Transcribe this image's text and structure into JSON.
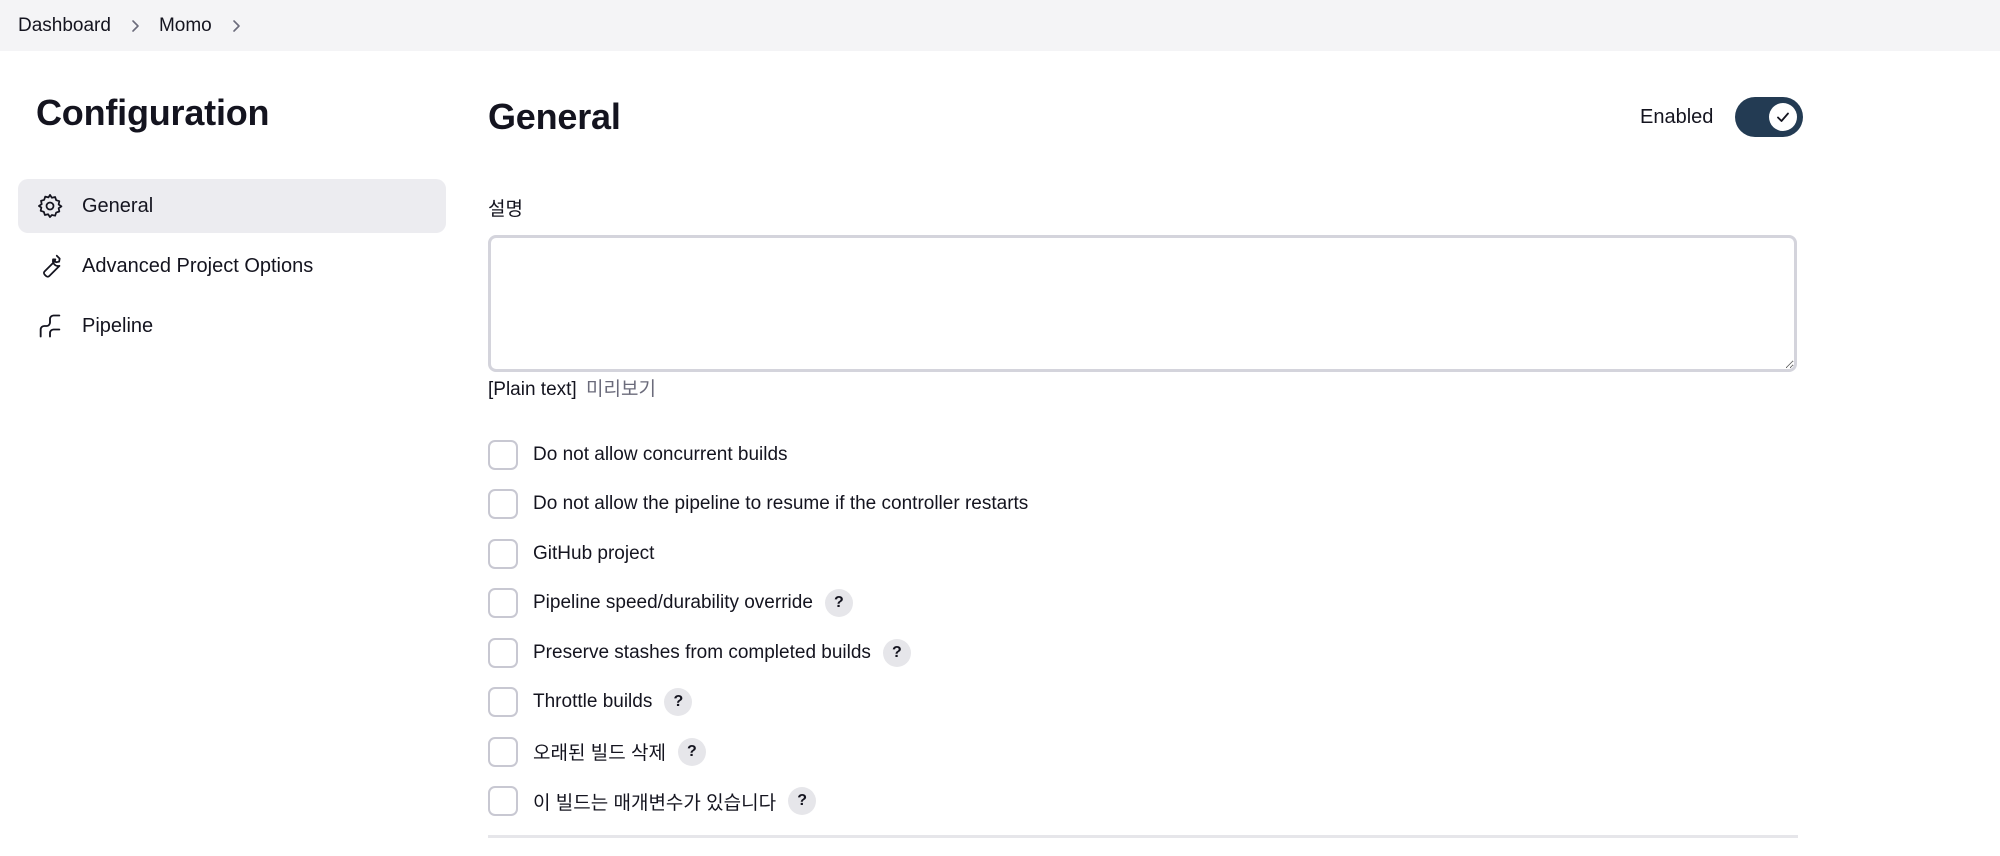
{
  "breadcrumb": {
    "items": [
      "Dashboard",
      "Momo"
    ]
  },
  "sidebar": {
    "title": "Configuration",
    "items": [
      {
        "label": "General",
        "icon": "gear-icon",
        "active": true
      },
      {
        "label": "Advanced Project Options",
        "icon": "wrench-icon",
        "active": false
      },
      {
        "label": "Pipeline",
        "icon": "pipeline-icon",
        "active": false
      }
    ]
  },
  "main": {
    "title": "General",
    "enabled_label": "Enabled",
    "enabled": true,
    "description_label": "설명",
    "description_value": "",
    "format_text": "[Plain text]",
    "preview_link": "미리보기",
    "options": [
      {
        "label": "Do not allow concurrent builds",
        "checked": false,
        "help": false
      },
      {
        "label": "Do not allow the pipeline to resume if the controller restarts",
        "checked": false,
        "help": false
      },
      {
        "label": "GitHub project",
        "checked": false,
        "help": false
      },
      {
        "label": "Pipeline speed/durability override",
        "checked": false,
        "help": true
      },
      {
        "label": "Preserve stashes from completed builds",
        "checked": false,
        "help": true
      },
      {
        "label": "Throttle builds",
        "checked": false,
        "help": true
      },
      {
        "label": "오래된 빌드 삭제",
        "checked": false,
        "help": true
      },
      {
        "label": "이 빌드는 매개변수가 있습니다",
        "checked": false,
        "help": true
      }
    ],
    "help_symbol": "?"
  },
  "colors": {
    "toggle_on": "#233b53",
    "breadcrumb_bg": "#f4f4f6",
    "active_item_bg": "#ececf0"
  }
}
